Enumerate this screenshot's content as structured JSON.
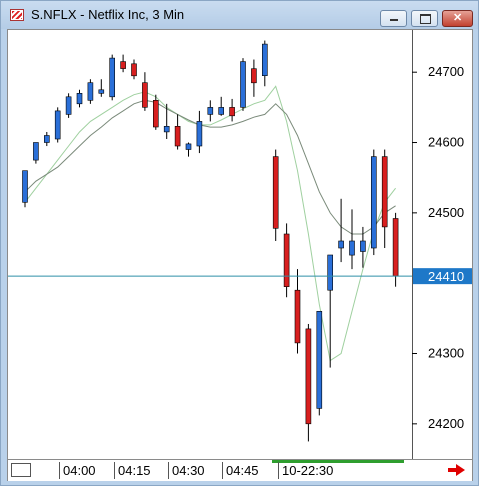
{
  "window": {
    "title": "S.NFLX - Netflix Inc, 3 Min",
    "buttons": {
      "minimize": "minimize",
      "maximize": "maximize",
      "close": "close"
    }
  },
  "colors": {
    "up_candle": "#2a6fd8",
    "down_candle": "#d81f1f",
    "wick": "#000000",
    "ma_fast": "#9fd09f",
    "ma_slow": "#7a8a7a",
    "last_price_line": "#2e8fa8",
    "last_price_box": "#1e78c8",
    "session_bar": "#2e9e2e"
  },
  "time_axis": {
    "labels": [
      "04:00",
      "04:15",
      "04:30",
      "04:45",
      "10-22:30"
    ]
  },
  "chart_data": {
    "type": "candlestick",
    "title": "S.NFLX - Netflix Inc, 3 Min",
    "ylim": [
      24150,
      24760
    ],
    "y_ticks": [
      "24700",
      "24600",
      "24500",
      "24300",
      "24200"
    ],
    "y_tick_values": [
      24700,
      24600,
      24500,
      24300,
      24200
    ],
    "last_price": 24410,
    "last_price_label": "24410",
    "candles": [
      {
        "o": 24515,
        "h": 24560,
        "l": 24508,
        "c": 24560
      },
      {
        "o": 24575,
        "h": 24600,
        "l": 24570,
        "c": 24600
      },
      {
        "o": 24600,
        "h": 24615,
        "l": 24595,
        "c": 24610
      },
      {
        "o": 24605,
        "h": 24650,
        "l": 24600,
        "c": 24645
      },
      {
        "o": 24640,
        "h": 24670,
        "l": 24635,
        "c": 24665
      },
      {
        "o": 24655,
        "h": 24675,
        "l": 24650,
        "c": 24670
      },
      {
        "o": 24660,
        "h": 24690,
        "l": 24655,
        "c": 24685
      },
      {
        "o": 24670,
        "h": 24690,
        "l": 24665,
        "c": 24675
      },
      {
        "o": 24665,
        "h": 24725,
        "l": 24660,
        "c": 24720
      },
      {
        "o": 24715,
        "h": 24725,
        "l": 24700,
        "c": 24705
      },
      {
        "o": 24712,
        "h": 24718,
        "l": 24690,
        "c": 24695
      },
      {
        "o": 24685,
        "h": 24700,
        "l": 24645,
        "c": 24650
      },
      {
        "o": 24660,
        "h": 24668,
        "l": 24618,
        "c": 24622
      },
      {
        "o": 24615,
        "h": 24655,
        "l": 24605,
        "c": 24623
      },
      {
        "o": 24623,
        "h": 24640,
        "l": 24590,
        "c": 24595
      },
      {
        "o": 24590,
        "h": 24600,
        "l": 24580,
        "c": 24598
      },
      {
        "o": 24595,
        "h": 24645,
        "l": 24585,
        "c": 24630
      },
      {
        "o": 24640,
        "h": 24660,
        "l": 24630,
        "c": 24650
      },
      {
        "o": 24640,
        "h": 24665,
        "l": 24638,
        "c": 24650
      },
      {
        "o": 24650,
        "h": 24662,
        "l": 24630,
        "c": 24638
      },
      {
        "o": 24650,
        "h": 24720,
        "l": 24645,
        "c": 24715
      },
      {
        "o": 24705,
        "h": 24718,
        "l": 24665,
        "c": 24685
      },
      {
        "o": 24695,
        "h": 24745,
        "l": 24680,
        "c": 24740
      },
      {
        "o": 24580,
        "h": 24590,
        "l": 24460,
        "c": 24478
      },
      {
        "o": 24470,
        "h": 24485,
        "l": 24380,
        "c": 24395
      },
      {
        "o": 24390,
        "h": 24420,
        "l": 24300,
        "c": 24315
      },
      {
        "o": 24335,
        "h": 24342,
        "l": 24175,
        "c": 24200
      },
      {
        "o": 24222,
        "h": 24360,
        "l": 24212,
        "c": 24360
      },
      {
        "o": 24390,
        "h": 24440,
        "l": 24280,
        "c": 24440
      },
      {
        "o": 24450,
        "h": 24520,
        "l": 24430,
        "c": 24460
      },
      {
        "o": 24440,
        "h": 24505,
        "l": 24420,
        "c": 24460
      },
      {
        "o": 24445,
        "h": 24480,
        "l": 24422,
        "c": 24460
      },
      {
        "o": 24450,
        "h": 24590,
        "l": 24440,
        "c": 24580
      },
      {
        "o": 24580,
        "h": 24590,
        "l": 24450,
        "c": 24480
      },
      {
        "o": 24492,
        "h": 24500,
        "l": 24395,
        "c": 24410
      }
    ],
    "series": [
      {
        "values": [
          24515,
          24535,
          24555,
          24575,
          24595,
          24615,
          24630,
          24640,
          24650,
          24660,
          24668,
          24672,
          24665,
          24650,
          24640,
          24630,
          24625,
          24625,
          24632,
          24640,
          24648,
          24655,
          24660,
          24680,
          24630,
          24560,
          24470,
          24370,
          24290,
          24300,
          24360,
          24420,
          24475,
          24515,
          24535
        ]
      },
      {
        "values": [
          24530,
          24545,
          24555,
          24565,
          24580,
          24595,
          24610,
          24622,
          24635,
          24645,
          24655,
          24660,
          24657,
          24648,
          24640,
          24632,
          24625,
          24622,
          24622,
          24625,
          24630,
          24636,
          24640,
          24655,
          24640,
          24610,
          24570,
          24530,
          24500,
          24480,
          24470,
          24470,
          24480,
          24500,
          24510
        ]
      }
    ]
  }
}
